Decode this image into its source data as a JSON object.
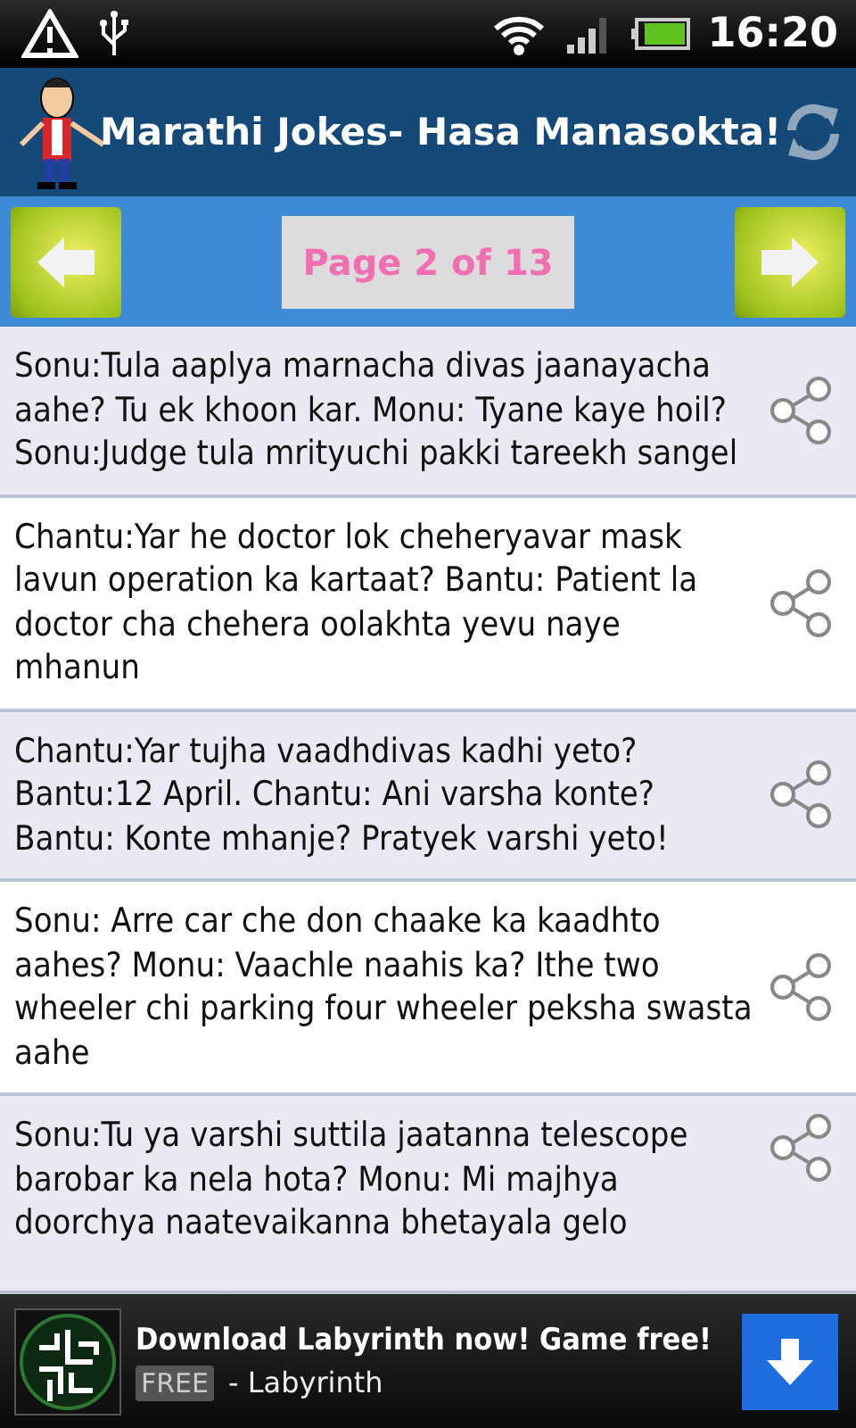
{
  "status_bar": {
    "time": "16:20"
  },
  "title_bar": {
    "title": "Marathi Jokes- Hasa Manasokta!"
  },
  "pager": {
    "label": "Page 2 of 13"
  },
  "jokes": [
    {
      "text": "Sonu:Tula aaplya marnacha divas jaanayacha aahe? Tu ek khoon kar. Monu: Tyane kaye hoil? Sonu:Judge tula mrityuchi pakki tareekh sangel"
    },
    {
      "text": "Chantu:Yar he doctor lok cheheryavar mask lavun operation ka kartaat? Bantu: Patient la doctor cha chehera oolakhta yevu naye mhanun"
    },
    {
      "text": "Chantu:Yar tujha vaadhdivas kadhi yeto? Bantu:12 April. Chantu: Ani varsha konte? Bantu: Konte mhanje? Pratyek varshi yeto!"
    },
    {
      "text": "Sonu: Arre car che don chaake ka kaadhto aahes? Monu: Vaachle naahis ka? Ithe two wheeler chi parking four wheeler peksha swasta aahe"
    },
    {
      "text": "Sonu:Tu ya varshi suttila jaatanna telescope barobar ka nela hota? Monu: Mi majhya doorchya naatevaikanna bhetayala gelo"
    }
  ],
  "ad": {
    "title": "Download Labyrinth now! Game free!",
    "badge": "FREE",
    "subtitle": "- Labyrinth"
  }
}
